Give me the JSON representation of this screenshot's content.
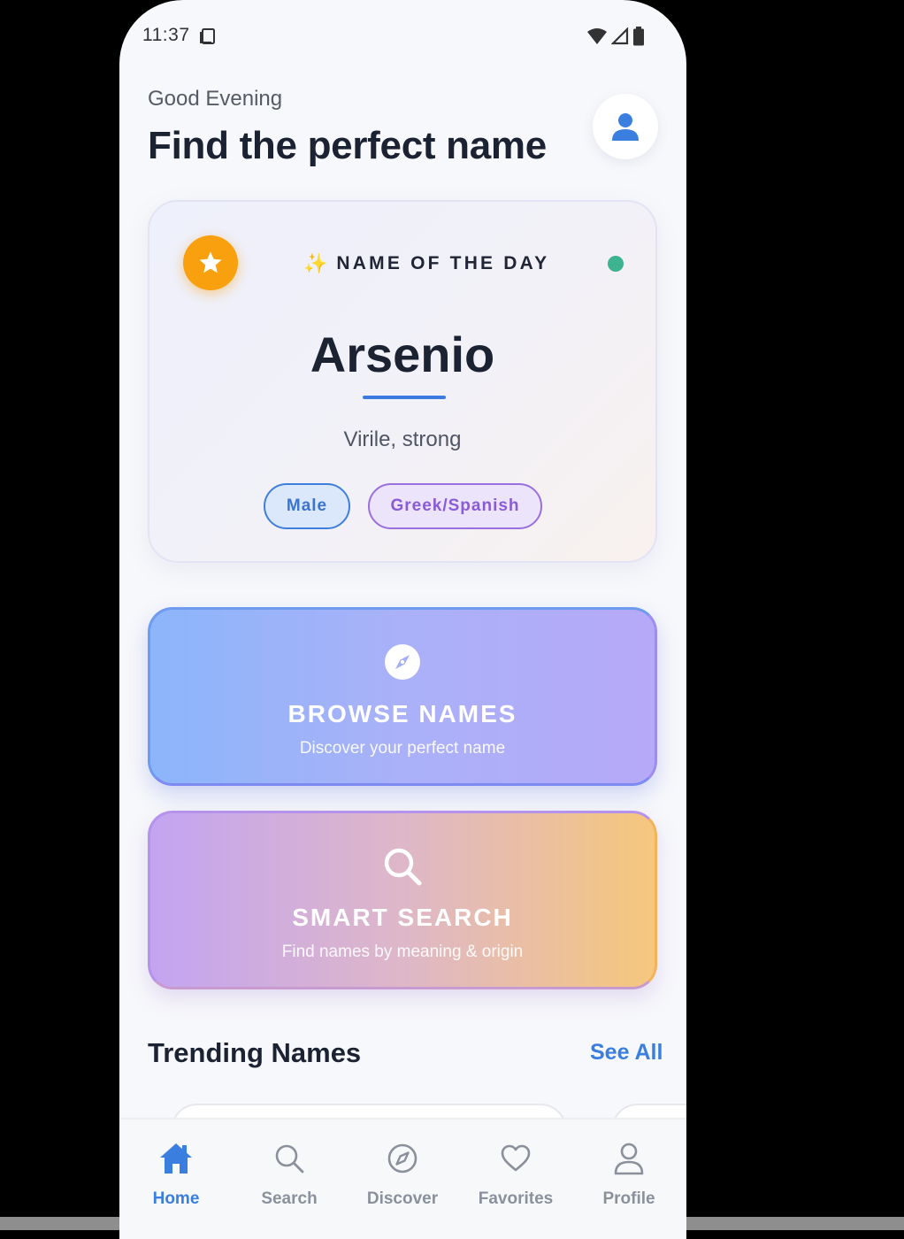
{
  "status_bar": {
    "time": "11:37"
  },
  "header": {
    "greeting": "Good Evening",
    "title": "Find the perfect name"
  },
  "name_of_the_day": {
    "label": "NAME OF THE DAY",
    "name": "Arsenio",
    "meaning": "Virile, strong",
    "gender": "Male",
    "origin": "Greek/Spanish"
  },
  "browse": {
    "title": "BROWSE NAMES",
    "subtitle": "Discover your perfect name"
  },
  "smart_search": {
    "title": "SMART SEARCH",
    "subtitle": "Find names by meaning & origin"
  },
  "trending": {
    "title": "Trending Names",
    "see_all": "See All"
  },
  "nav": {
    "active": "Home",
    "items": [
      {
        "label": "Home",
        "icon": "home-icon"
      },
      {
        "label": "Search",
        "icon": "search-icon"
      },
      {
        "label": "Discover",
        "icon": "compass-icon"
      },
      {
        "label": "Favorites",
        "icon": "heart-icon"
      },
      {
        "label": "Profile",
        "icon": "person-icon"
      }
    ]
  },
  "colors": {
    "accent_blue": "#3a7ee0",
    "star_orange": "#f8a00e",
    "live_green": "#3db48f",
    "origin_purple": "#8a5bd6"
  }
}
